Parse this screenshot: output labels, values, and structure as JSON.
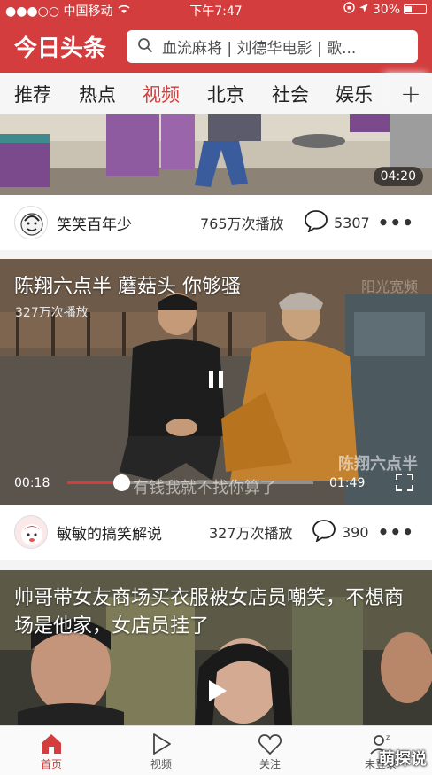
{
  "status_bar": {
    "carrier": "●●●○○ 中国移动",
    "time": "下午7:47",
    "battery": "30%"
  },
  "header": {
    "logo": "今日头条",
    "search_placeholder": "血流麻将 | 刘德华电影 | 歌..."
  },
  "tabs": {
    "items": [
      {
        "label": "推荐"
      },
      {
        "label": "热点"
      },
      {
        "label": "视频"
      },
      {
        "label": "北京"
      },
      {
        "label": "社会"
      },
      {
        "label": "娱乐"
      }
    ],
    "active": "视频",
    "plus": "+"
  },
  "feed": [
    {
      "duration": "04:20",
      "author": "笑笑百年少",
      "views": "765万次播放",
      "comments": "5307"
    },
    {
      "title": "陈翔六点半 蘑菇头 你够骚",
      "views_overlay": "327万次播放",
      "watermark_top": "阳光宽频",
      "watermark_bottom": "陈翔六点半",
      "subtitle": "有钱我就不找你算了",
      "current_time": "00:18",
      "total_time": "01:49",
      "progress": 0.22,
      "author": "敏敏的搞笑解说",
      "views": "327万次播放",
      "comments": "390"
    },
    {
      "title": "帅哥带女友商场买衣服被女店员嘲笑，不想商场是他家，女店员挂了"
    }
  ],
  "bottom_nav": {
    "items": [
      {
        "label": "首页"
      },
      {
        "label": "视频"
      },
      {
        "label": "关注"
      },
      {
        "label": "未登录"
      }
    ],
    "active": "首页"
  },
  "site_watermark": "萌探说",
  "colors": {
    "brand_red": "#d43d3d",
    "text": "#222222"
  }
}
